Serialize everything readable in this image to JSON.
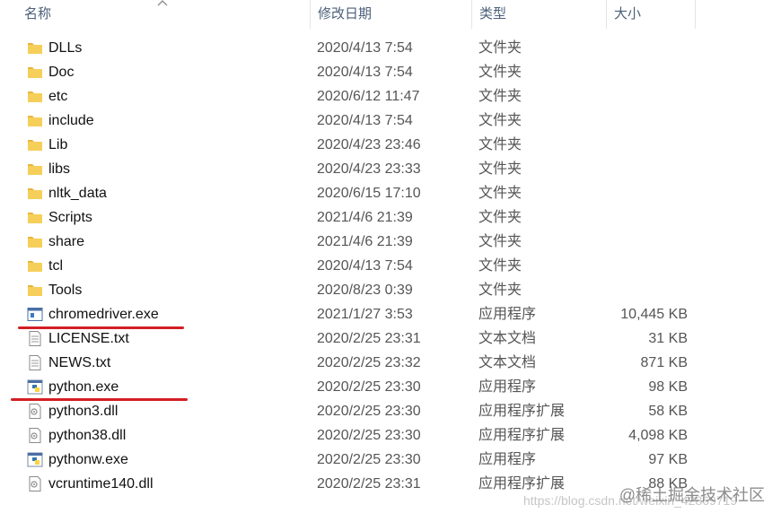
{
  "columns": {
    "name": "名称",
    "date": "修改日期",
    "type": "类型",
    "size": "大小"
  },
  "files": [
    {
      "name": "DLLs",
      "date": "2020/4/13 7:54",
      "type": "文件夹",
      "size": "",
      "icon": "folder-icon"
    },
    {
      "name": "Doc",
      "date": "2020/4/13 7:54",
      "type": "文件夹",
      "size": "",
      "icon": "folder-icon"
    },
    {
      "name": "etc",
      "date": "2020/6/12 11:47",
      "type": "文件夹",
      "size": "",
      "icon": "folder-icon"
    },
    {
      "name": "include",
      "date": "2020/4/13 7:54",
      "type": "文件夹",
      "size": "",
      "icon": "folder-icon"
    },
    {
      "name": "Lib",
      "date": "2020/4/23 23:46",
      "type": "文件夹",
      "size": "",
      "icon": "folder-icon"
    },
    {
      "name": "libs",
      "date": "2020/4/23 23:33",
      "type": "文件夹",
      "size": "",
      "icon": "folder-icon"
    },
    {
      "name": "nltk_data",
      "date": "2020/6/15 17:10",
      "type": "文件夹",
      "size": "",
      "icon": "folder-icon"
    },
    {
      "name": "Scripts",
      "date": "2021/4/6 21:39",
      "type": "文件夹",
      "size": "",
      "icon": "folder-icon"
    },
    {
      "name": "share",
      "date": "2021/4/6 21:39",
      "type": "文件夹",
      "size": "",
      "icon": "folder-icon"
    },
    {
      "name": "tcl",
      "date": "2020/4/13 7:54",
      "type": "文件夹",
      "size": "",
      "icon": "folder-icon"
    },
    {
      "name": "Tools",
      "date": "2020/8/23 0:39",
      "type": "文件夹",
      "size": "",
      "icon": "folder-icon"
    },
    {
      "name": "chromedriver.exe",
      "date": "2021/1/27 3:53",
      "type": "应用程序",
      "size": "10,445 KB",
      "icon": "application-icon"
    },
    {
      "name": "LICENSE.txt",
      "date": "2020/2/25 23:31",
      "type": "文本文档",
      "size": "31 KB",
      "icon": "text-document-icon"
    },
    {
      "name": "NEWS.txt",
      "date": "2020/2/25 23:32",
      "type": "文本文档",
      "size": "871 KB",
      "icon": "text-document-icon"
    },
    {
      "name": "python.exe",
      "date": "2020/2/25 23:30",
      "type": "应用程序",
      "size": "98 KB",
      "icon": "python-icon"
    },
    {
      "name": "python3.dll",
      "date": "2020/2/25 23:30",
      "type": "应用程序扩展",
      "size": "58 KB",
      "icon": "dll-icon"
    },
    {
      "name": "python38.dll",
      "date": "2020/2/25 23:30",
      "type": "应用程序扩展",
      "size": "4,098 KB",
      "icon": "dll-icon"
    },
    {
      "name": "pythonw.exe",
      "date": "2020/2/25 23:30",
      "type": "应用程序",
      "size": "97 KB",
      "icon": "python-icon"
    },
    {
      "name": "vcruntime140.dll",
      "date": "2020/2/25 23:31",
      "type": "应用程序扩展",
      "size": "88 KB",
      "icon": "dll-icon"
    }
  ],
  "watermark": {
    "text": "@稀土掘金技术社区",
    "url": "https://blog.csdn.net/weixin_42869719"
  },
  "colors": {
    "header_text": "#4c607a",
    "folder": "#f1c34b",
    "underline": "#d41e25"
  }
}
